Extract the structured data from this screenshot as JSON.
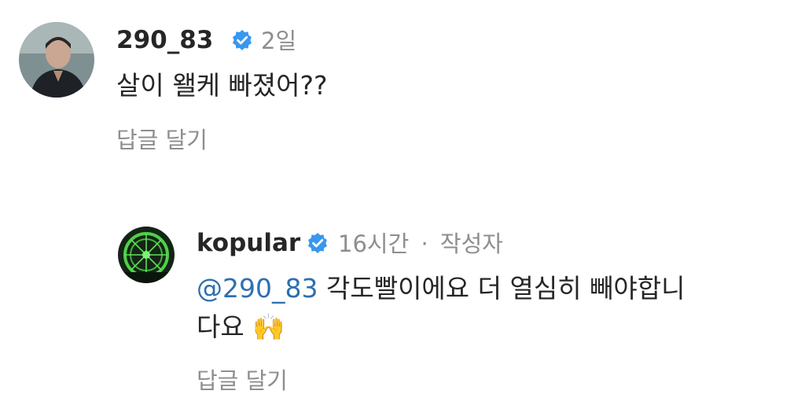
{
  "comments": [
    {
      "username": "290_83",
      "verified": true,
      "time": "2일",
      "text": "살이 왤케 빠졌어??",
      "reply_label": "답글 달기"
    }
  ],
  "replies": [
    {
      "username": "kopular",
      "verified": true,
      "time": "16시간",
      "separator": "·",
      "author_label": "작성자",
      "mention": "@290_83",
      "text_line1": "각도빨이에요 더 열심히 빼야합니",
      "text_line2": "다요",
      "emoji": "🙌",
      "reply_label": "답글 달기"
    }
  ],
  "colors": {
    "text": "#262626",
    "secondary": "#8e8e8e",
    "mention": "#2f6fb1",
    "verified_badge": "#3897f0"
  }
}
